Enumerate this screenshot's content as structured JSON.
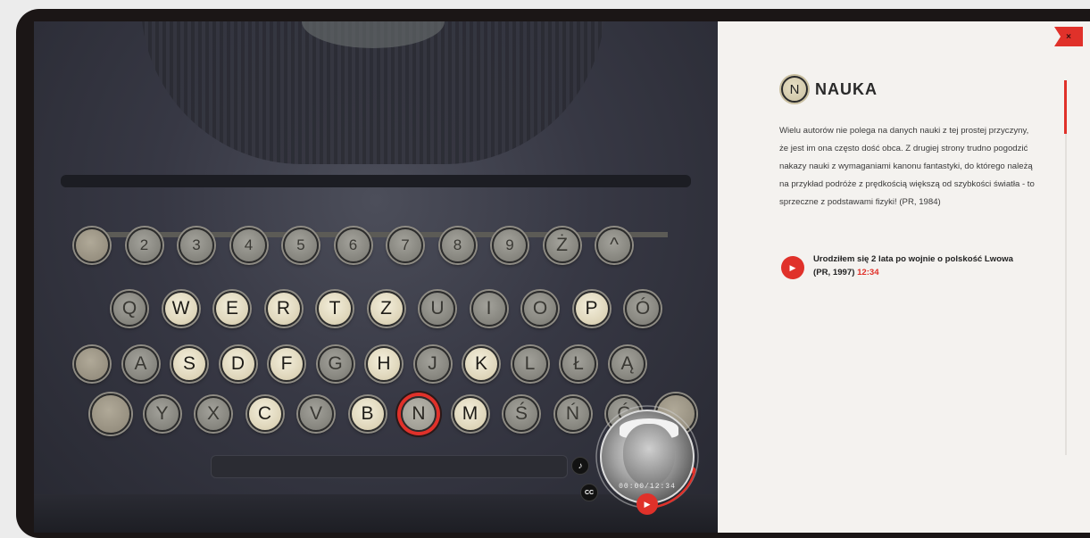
{
  "stage": {
    "rows": [
      [
        {
          "label": "",
          "style": "blank"
        },
        {
          "label": "2",
          "style": "dim",
          "name": "key-2"
        },
        {
          "label": "3",
          "style": "dim",
          "name": "key-3"
        },
        {
          "label": "4",
          "style": "dim",
          "name": "key-4"
        },
        {
          "label": "5",
          "style": "dim",
          "name": "key-5"
        },
        {
          "label": "6",
          "style": "dim",
          "name": "key-6"
        },
        {
          "label": "7",
          "style": "dim",
          "name": "key-7"
        },
        {
          "label": "8",
          "style": "dim",
          "name": "key-8"
        },
        {
          "label": "9",
          "style": "dim",
          "name": "key-9"
        },
        {
          "label": "Ż",
          "style": "dim",
          "name": "key-z-dot"
        },
        {
          "label": "^",
          "style": "dim",
          "name": "key-caret"
        }
      ],
      [
        {
          "label": "Q",
          "style": "dim",
          "name": "key-q"
        },
        {
          "label": "W",
          "style": "lit",
          "name": "key-w"
        },
        {
          "label": "E",
          "style": "lit",
          "name": "key-e"
        },
        {
          "label": "R",
          "style": "lit",
          "name": "key-r"
        },
        {
          "label": "T",
          "style": "lit",
          "name": "key-t"
        },
        {
          "label": "Z",
          "style": "lit",
          "name": "key-z"
        },
        {
          "label": "U",
          "style": "dim",
          "name": "key-u"
        },
        {
          "label": "I",
          "style": "dim",
          "name": "key-i"
        },
        {
          "label": "O",
          "style": "dim",
          "name": "key-o"
        },
        {
          "label": "P",
          "style": "lit",
          "name": "key-p"
        },
        {
          "label": "Ó",
          "style": "dim",
          "name": "key-o-acute"
        }
      ],
      [
        {
          "label": "",
          "style": "blank"
        },
        {
          "label": "A",
          "style": "dim",
          "name": "key-a"
        },
        {
          "label": "S",
          "style": "lit",
          "name": "key-s"
        },
        {
          "label": "D",
          "style": "lit",
          "name": "key-d"
        },
        {
          "label": "F",
          "style": "lit",
          "name": "key-f"
        },
        {
          "label": "G",
          "style": "dim",
          "name": "key-g"
        },
        {
          "label": "H",
          "style": "lit",
          "name": "key-h"
        },
        {
          "label": "J",
          "style": "dim",
          "name": "key-j"
        },
        {
          "label": "K",
          "style": "lit",
          "name": "key-k"
        },
        {
          "label": "L",
          "style": "dim",
          "name": "key-l"
        },
        {
          "label": "Ł",
          "style": "dim",
          "name": "key-l-stroke"
        },
        {
          "label": "Ą",
          "style": "dim",
          "name": "key-a-ogonek"
        }
      ],
      [
        {
          "label": "",
          "style": "blank"
        },
        {
          "label": "Y",
          "style": "dim",
          "name": "key-y"
        },
        {
          "label": "X",
          "style": "dim",
          "name": "key-x"
        },
        {
          "label": "C",
          "style": "lit",
          "name": "key-c"
        },
        {
          "label": "V",
          "style": "dim",
          "name": "key-v"
        },
        {
          "label": "B",
          "style": "lit",
          "name": "key-b"
        },
        {
          "label": "N",
          "style": "active",
          "name": "key-n"
        },
        {
          "label": "M",
          "style": "lit",
          "name": "key-m"
        },
        {
          "label": "Ś",
          "style": "dim",
          "name": "key-s-acute"
        },
        {
          "label": "Ń",
          "style": "dim",
          "name": "key-n-acute"
        },
        {
          "label": "Ć",
          "style": "dim",
          "name": "key-c-acute"
        },
        {
          "label": "",
          "style": "blank"
        }
      ]
    ],
    "controls": {
      "music_icon": "♪",
      "cc_label": "CC"
    },
    "portrait": {
      "timecode": "00:00/12:34",
      "play_icon": "▶"
    }
  },
  "panel": {
    "close_label": "×",
    "entry": {
      "letter": "N",
      "title": "NAUKA"
    },
    "body": "Wielu autorów nie polega na danych nauki z tej prostej przyczyny, że jest im ona często dość obca. Z drugiej strony trudno pogodzić nakazy nauki z wymaganiami kanonu fantastyki, do którego należą na przykład podróże z prędkością większą od szybkości światła - to sprzeczne z podstawami fizyki! (PR, 1984)",
    "clip": {
      "play_icon": "▶",
      "title": "Urodziłem się 2 lata po wojnie o polskość Lwowa (PR, 1997)",
      "duration": "12:34"
    }
  },
  "colors": {
    "accent": "#e0312a",
    "panel_bg": "#f4f2ef",
    "frame": "#1b1616"
  }
}
